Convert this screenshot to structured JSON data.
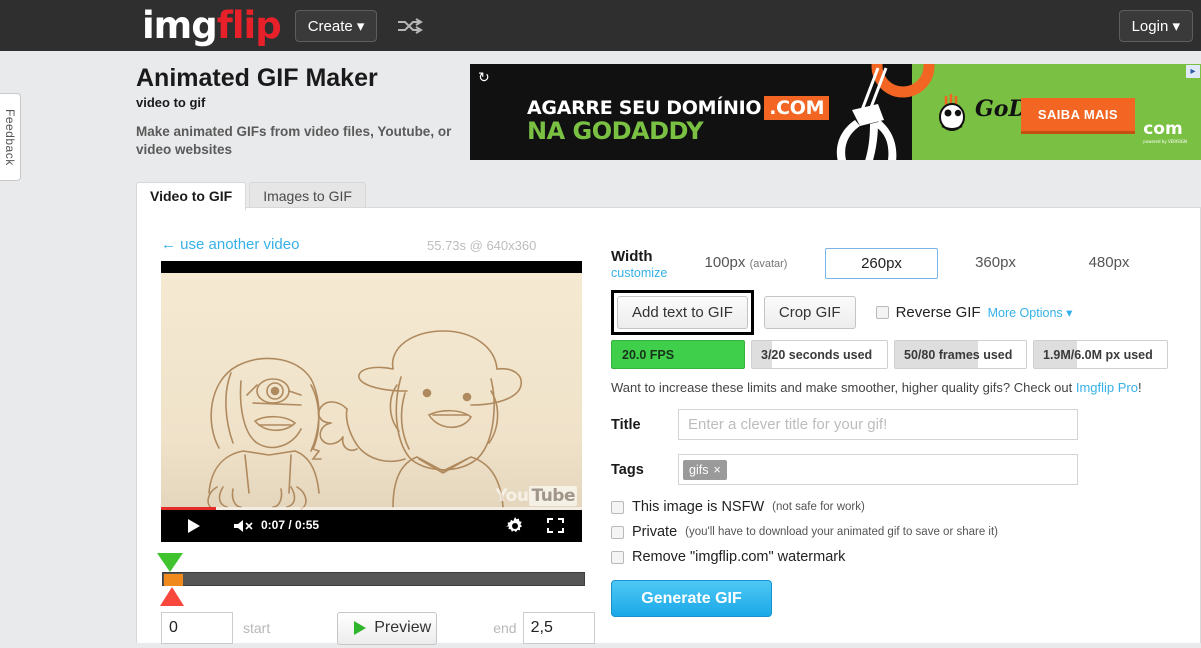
{
  "topnav": {
    "logo_img": "img",
    "logo_flip": "flip",
    "create_label": "Create ▾",
    "shuffle_icon": "shuffle-icon",
    "login_label": "Login ▾"
  },
  "feedback": {
    "label": "Feedback"
  },
  "page": {
    "title": "Animated GIF Maker",
    "subtitle": "video to gif",
    "description": "Make animated GIFs from video files, Youtube, or video websites"
  },
  "ad": {
    "refresh_icon": "refresh-icon",
    "line1": "AGARRE SEU DOMÍNIO",
    "line1_badge": ".COM",
    "line2": "NA GODADDY",
    "brand": "GoDaddy",
    "cta": "SAIBA MAIS",
    "com_logo": "com",
    "com_sub": "powered by VERISIGN",
    "adchoices_icon": "adchoices-icon",
    "bg_green": "#7ac143",
    "accent_orange": "#f26522"
  },
  "tabs": [
    {
      "label": "Video to GIF",
      "active": true
    },
    {
      "label": "Images to GIF",
      "active": false
    }
  ],
  "left": {
    "use_another_video": "← use another video",
    "video_meta": "55.73s @ 640x360",
    "youtube_watermark_you": "You",
    "youtube_watermark_tube": "Tube",
    "controls": {
      "play_icon": "play-icon",
      "mute_icon": "mute-icon",
      "time": "0:07 / 0:55",
      "gear_icon": "gear-icon",
      "fullscreen_icon": "fullscreen-icon"
    },
    "progress_percent": 13,
    "timeline": {
      "selection_percent": 4.5,
      "start_marker_icon": "start-marker-icon",
      "end_marker_icon": "end-marker-icon"
    },
    "start_value": "0",
    "start_label": "start",
    "end_label": "end",
    "end_value": "2,5",
    "preview_label": "Preview",
    "preview_icon": "play-icon"
  },
  "right": {
    "width": {
      "label": "Width",
      "customize": "customize",
      "options": [
        {
          "label": "100px",
          "note": "(avatar)",
          "selected": false
        },
        {
          "label": "260px",
          "note": "",
          "selected": true
        },
        {
          "label": "360px",
          "note": "",
          "selected": false
        },
        {
          "label": "480px",
          "note": "",
          "selected": false
        }
      ]
    },
    "buttons": {
      "add_text": "Add text to GIF",
      "crop": "Crop GIF",
      "reverse": "Reverse GIF",
      "more_options": "More Options ▾"
    },
    "stats": [
      {
        "text": "20.0 FPS",
        "fill": 0,
        "highlight": true
      },
      {
        "text": "3/20 seconds used",
        "fill": 15,
        "highlight": false
      },
      {
        "text": "50/80 frames used",
        "fill": 63,
        "highlight": false
      },
      {
        "text": "1.9M/6.0M px used",
        "fill": 32,
        "highlight": false
      }
    ],
    "pro_line_before": "Want to increase these limits and make smoother, higher quality gifs? Check out ",
    "pro_link": "Imgflip Pro",
    "pro_line_after": "!",
    "title_label": "Title",
    "title_placeholder": "Enter a clever title for your gif!",
    "title_value": "",
    "tags_label": "Tags",
    "tags": [
      {
        "name": "gifs",
        "remove_icon": "×"
      }
    ],
    "checkboxes": [
      {
        "main": "This image is NSFW",
        "note": "(not safe for work)"
      },
      {
        "main": "Private",
        "note": "(you'll have to download your animated gif to save or share it)"
      },
      {
        "main": "Remove \"imgflip.com\" watermark",
        "note": ""
      }
    ],
    "generate_label": "Generate GIF",
    "accent_blue": "#36b0e8",
    "fps_green": "#3fcf4a"
  }
}
